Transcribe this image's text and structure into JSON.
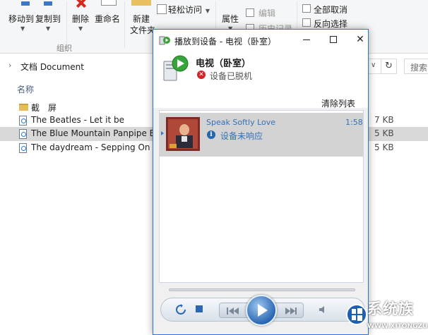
{
  "ribbon": {
    "move_to": "移动到",
    "copy_to": "复制到",
    "delete": "删除",
    "rename": "重命名",
    "new_folder_line1": "新建",
    "new_folder_line2": "文件夹",
    "easy_access": "轻松访问",
    "properties": "属性",
    "edit": "编辑",
    "history": "历史记录",
    "select_none": "全部取消",
    "invert_selection": "反向选择",
    "group_organize": "组织"
  },
  "address": {
    "path": "文档 Document",
    "search_placeholder": "搜索"
  },
  "file_list": {
    "column_name": "名称",
    "rows": [
      {
        "name": "截　屏",
        "type": "folder",
        "size": "",
        "selected": false
      },
      {
        "name": "The Beatles - Let it be",
        "type": "audio",
        "size": "7 KB",
        "selected": false
      },
      {
        "name": "The Blue Mountain Panpipe Ense",
        "type": "audio",
        "size": "5 KB",
        "selected": true
      },
      {
        "name": "The daydream - Sepping On The",
        "type": "audio",
        "size": "5 KB",
        "selected": false
      }
    ]
  },
  "dialog": {
    "title": "播放到设备 - 电视（卧室）",
    "device_name": "电视（卧室）",
    "device_status": "设备已脱机",
    "clear_list": "清除列表",
    "track": {
      "title": "Speak Softly Love",
      "duration": "1:58",
      "status": "设备未响应"
    },
    "accent_color": "#2b74d6"
  },
  "watermark": {
    "brand": "系统族",
    "url": "WWW.XITONGZU.COM"
  }
}
